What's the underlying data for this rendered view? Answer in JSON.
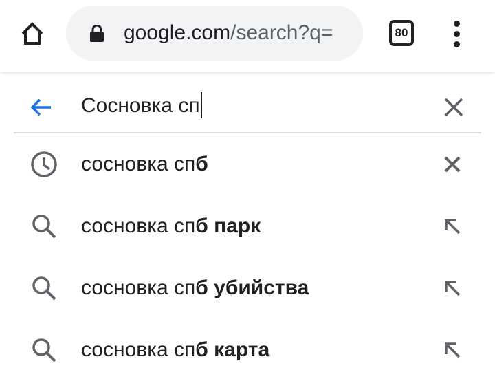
{
  "toolbar": {
    "url_host": "google.com",
    "url_path": "/search?q=",
    "tab_count": "80"
  },
  "search": {
    "query": "Сосновка сп"
  },
  "suggestions": [
    {
      "type": "history",
      "prefix": "сосновка сп",
      "bold": "б",
      "action": "remove"
    },
    {
      "type": "search",
      "prefix": "сосновка сп",
      "bold": "б парк",
      "action": "refine"
    },
    {
      "type": "search",
      "prefix": "сосновка сп",
      "bold": "б убийства",
      "action": "refine"
    },
    {
      "type": "search",
      "prefix": "сосновка сп",
      "bold": "б карта",
      "action": "refine"
    }
  ],
  "colors": {
    "accent": "#1a73e8",
    "icon_gray": "#5f6368",
    "omnibox_bg": "#f1f3f4"
  }
}
